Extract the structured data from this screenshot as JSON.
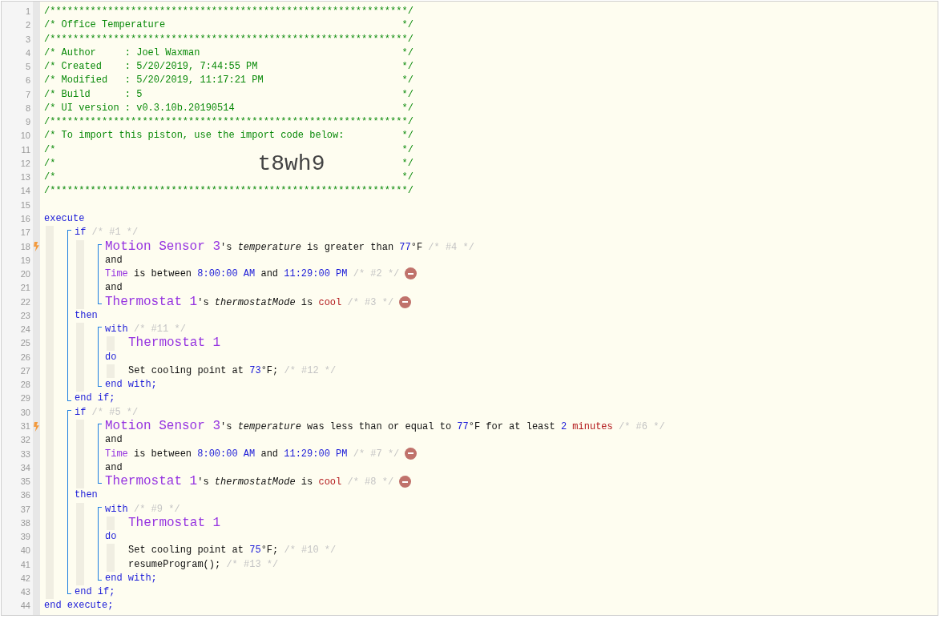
{
  "editor": {
    "lines": [
      {
        "kind": "framed",
        "number": "1",
        "tokens": [
          {
            "text": "/**************************************************************/",
            "kind": "comment"
          }
        ]
      },
      {
        "kind": "framed",
        "number": "2",
        "tokens": [
          {
            "text": "/* Office Temperature",
            "kind": "comment"
          },
          {
            "text": "*/",
            "kind": "comment"
          }
        ]
      },
      {
        "kind": "framed",
        "number": "3",
        "tokens": [
          {
            "text": "/**************************************************************/",
            "kind": "comment"
          }
        ]
      },
      {
        "kind": "framed",
        "number": "4",
        "tokens": [
          {
            "text": "/* Author     : Joel Waxman",
            "kind": "comment"
          },
          {
            "text": "*/",
            "kind": "comment"
          }
        ]
      },
      {
        "kind": "framed",
        "number": "5",
        "tokens": [
          {
            "text": "/* Created    : 5/20/2019, 7:44:55 PM",
            "kind": "comment"
          },
          {
            "text": "*/",
            "kind": "comment"
          }
        ]
      },
      {
        "kind": "framed",
        "number": "6",
        "tokens": [
          {
            "text": "/* Modified   : 5/20/2019, 11:17:21 PM",
            "kind": "comment"
          },
          {
            "text": "*/",
            "kind": "comment"
          }
        ]
      },
      {
        "kind": "framed",
        "number": "7",
        "tokens": [
          {
            "text": "/* Build      : 5",
            "kind": "comment"
          },
          {
            "text": "*/",
            "kind": "comment"
          }
        ]
      },
      {
        "kind": "framed",
        "number": "8",
        "tokens": [
          {
            "text": "/* UI version : v0.3.10b.20190514",
            "kind": "comment"
          },
          {
            "text": "*/",
            "kind": "comment"
          }
        ]
      },
      {
        "kind": "framed",
        "number": "9",
        "tokens": [
          {
            "text": "/**************************************************************/",
            "kind": "comment"
          }
        ]
      },
      {
        "kind": "framed",
        "number": "10",
        "tokens": [
          {
            "text": "/* To import this piston, use the import code below:",
            "kind": "comment"
          },
          {
            "text": "*/",
            "kind": "comment"
          }
        ]
      },
      {
        "kind": "framed",
        "number": "11",
        "tokens": [
          {
            "text": "/*",
            "kind": "comment"
          },
          {
            "text": "*/",
            "kind": "comment"
          }
        ]
      },
      {
        "kind": "framed",
        "number": "12",
        "tokens": [
          {
            "text": "/*",
            "kind": "comment"
          },
          {
            "text": "t8wh9",
            "kind": "code"
          },
          {
            "text": "*/",
            "kind": "comment"
          }
        ]
      },
      {
        "kind": "framed",
        "number": "13",
        "tokens": [
          {
            "text": "/*",
            "kind": "comment"
          },
          {
            "text": "*/",
            "kind": "comment"
          }
        ]
      },
      {
        "kind": "framed",
        "number": "14",
        "tokens": [
          {
            "text": "/**************************************************************/",
            "kind": "comment"
          }
        ]
      },
      {
        "kind": "blank",
        "number": "15"
      },
      {
        "kind": "line",
        "number": "16",
        "trigger": false,
        "removable": false,
        "tokens": [
          {
            "text": "execute",
            "kind": "keyword"
          }
        ]
      },
      {
        "kind": "block",
        "children": [
          {
            "kind": "group",
            "children": [
              {
                "kind": "line",
                "number": "17",
                "trigger": false,
                "removable": false,
                "tokens": [
                  {
                    "text": "if",
                    "kind": "keyword"
                  },
                  {
                    "text": "/* #1 */",
                    "kind": "note"
                  }
                ]
              },
              {
                "kind": "block",
                "children": [
                  {
                    "kind": "group",
                    "children": [
                      {
                        "kind": "line",
                        "number": "18",
                        "trigger": true,
                        "removable": false,
                        "tokens": [
                          {
                            "text": "Motion Sensor 3",
                            "kind": "device"
                          },
                          {
                            "text": "'s",
                            "kind": "plain",
                            "join": true
                          },
                          {
                            "text": "temperature",
                            "kind": "attribute"
                          },
                          {
                            "text": "is greater than",
                            "kind": "plain"
                          },
                          {
                            "text": "77",
                            "kind": "value"
                          },
                          {
                            "text": "°F",
                            "kind": "plain",
                            "join": true
                          },
                          {
                            "text": "/* #4 */",
                            "kind": "note"
                          }
                        ]
                      },
                      {
                        "kind": "line",
                        "number": "19",
                        "trigger": false,
                        "removable": false,
                        "tokens": [
                          {
                            "text": "and",
                            "kind": "plain"
                          }
                        ]
                      },
                      {
                        "kind": "line",
                        "number": "20",
                        "trigger": false,
                        "removable": true,
                        "tokens": [
                          {
                            "text": "Time",
                            "kind": "variable"
                          },
                          {
                            "text": "is between",
                            "kind": "plain"
                          },
                          {
                            "text": "8:00:00 AM",
                            "kind": "value"
                          },
                          {
                            "text": "and",
                            "kind": "plain"
                          },
                          {
                            "text": "11:29:00 PM",
                            "kind": "value"
                          },
                          {
                            "text": "/* #2 */",
                            "kind": "note"
                          }
                        ]
                      },
                      {
                        "kind": "line",
                        "number": "21",
                        "trigger": false,
                        "removable": false,
                        "tokens": [
                          {
                            "text": "and",
                            "kind": "plain"
                          }
                        ]
                      },
                      {
                        "kind": "line",
                        "number": "22",
                        "trigger": false,
                        "removable": true,
                        "tokens": [
                          {
                            "text": "Thermostat 1",
                            "kind": "device"
                          },
                          {
                            "text": "'s",
                            "kind": "plain",
                            "join": true
                          },
                          {
                            "text": "thermostatMode",
                            "kind": "attribute"
                          },
                          {
                            "text": "is",
                            "kind": "plain"
                          },
                          {
                            "text": "cool",
                            "kind": "enum"
                          },
                          {
                            "text": "/* #3 */",
                            "kind": "note"
                          }
                        ]
                      }
                    ]
                  }
                ]
              },
              {
                "kind": "line",
                "number": "23",
                "trigger": false,
                "removable": false,
                "tokens": [
                  {
                    "text": "then",
                    "kind": "keyword"
                  }
                ]
              },
              {
                "kind": "block",
                "children": [
                  {
                    "kind": "group",
                    "children": [
                      {
                        "kind": "line",
                        "number": "24",
                        "trigger": false,
                        "removable": false,
                        "tokens": [
                          {
                            "text": "with",
                            "kind": "keyword"
                          },
                          {
                            "text": "/* #11 */",
                            "kind": "note"
                          }
                        ]
                      },
                      {
                        "kind": "block",
                        "children": [
                          {
                            "kind": "line",
                            "number": "25",
                            "trigger": false,
                            "removable": false,
                            "tokens": [
                              {
                                "text": "Thermostat 1",
                                "kind": "device"
                              }
                            ]
                          }
                        ]
                      },
                      {
                        "kind": "line",
                        "number": "26",
                        "trigger": false,
                        "removable": false,
                        "tokens": [
                          {
                            "text": "do",
                            "kind": "keyword"
                          }
                        ]
                      },
                      {
                        "kind": "block",
                        "children": [
                          {
                            "kind": "line",
                            "number": "27",
                            "trigger": false,
                            "removable": false,
                            "tokens": [
                              {
                                "text": "Set cooling point at",
                                "kind": "plain"
                              },
                              {
                                "text": "73",
                                "kind": "value"
                              },
                              {
                                "text": "°F;",
                                "kind": "plain",
                                "join": true
                              },
                              {
                                "text": "/* #12 */",
                                "kind": "note"
                              }
                            ]
                          }
                        ]
                      },
                      {
                        "kind": "line",
                        "number": "28",
                        "trigger": false,
                        "removable": false,
                        "tokens": [
                          {
                            "text": "end with;",
                            "kind": "keyword"
                          }
                        ]
                      }
                    ]
                  }
                ]
              },
              {
                "kind": "line",
                "number": "29",
                "trigger": false,
                "removable": false,
                "tokens": [
                  {
                    "text": "end if;",
                    "kind": "keyword"
                  }
                ]
              }
            ]
          },
          {
            "kind": "group",
            "children": [
              {
                "kind": "line",
                "number": "30",
                "trigger": false,
                "removable": false,
                "tokens": [
                  {
                    "text": "if",
                    "kind": "keyword"
                  },
                  {
                    "text": "/* #5 */",
                    "kind": "note"
                  }
                ]
              },
              {
                "kind": "block",
                "children": [
                  {
                    "kind": "group",
                    "children": [
                      {
                        "kind": "line",
                        "number": "31",
                        "trigger": true,
                        "removable": false,
                        "tokens": [
                          {
                            "text": "Motion Sensor 3",
                            "kind": "device"
                          },
                          {
                            "text": "'s",
                            "kind": "plain",
                            "join": true
                          },
                          {
                            "text": "temperature",
                            "kind": "attribute"
                          },
                          {
                            "text": "was less than or equal to",
                            "kind": "plain"
                          },
                          {
                            "text": "77",
                            "kind": "value"
                          },
                          {
                            "text": "°F",
                            "kind": "plain",
                            "join": true
                          },
                          {
                            "text": "for at least",
                            "kind": "plain"
                          },
                          {
                            "text": "2",
                            "kind": "value"
                          },
                          {
                            "text": "minutes",
                            "kind": "enum"
                          },
                          {
                            "text": "/* #6 */",
                            "kind": "note"
                          }
                        ]
                      },
                      {
                        "kind": "line",
                        "number": "32",
                        "trigger": false,
                        "removable": false,
                        "tokens": [
                          {
                            "text": "and",
                            "kind": "plain"
                          }
                        ]
                      },
                      {
                        "kind": "line",
                        "number": "33",
                        "trigger": false,
                        "removable": true,
                        "tokens": [
                          {
                            "text": "Time",
                            "kind": "variable"
                          },
                          {
                            "text": "is between",
                            "kind": "plain"
                          },
                          {
                            "text": "8:00:00 AM",
                            "kind": "value"
                          },
                          {
                            "text": "and",
                            "kind": "plain"
                          },
                          {
                            "text": "11:29:00 PM",
                            "kind": "value"
                          },
                          {
                            "text": "/* #7 */",
                            "kind": "note"
                          }
                        ]
                      },
                      {
                        "kind": "line",
                        "number": "34",
                        "trigger": false,
                        "removable": false,
                        "tokens": [
                          {
                            "text": "and",
                            "kind": "plain"
                          }
                        ]
                      },
                      {
                        "kind": "line",
                        "number": "35",
                        "trigger": false,
                        "removable": true,
                        "tokens": [
                          {
                            "text": "Thermostat 1",
                            "kind": "device"
                          },
                          {
                            "text": "'s",
                            "kind": "plain",
                            "join": true
                          },
                          {
                            "text": "thermostatMode",
                            "kind": "attribute"
                          },
                          {
                            "text": "is",
                            "kind": "plain"
                          },
                          {
                            "text": "cool",
                            "kind": "enum"
                          },
                          {
                            "text": "/* #8 */",
                            "kind": "note"
                          }
                        ]
                      }
                    ]
                  }
                ]
              },
              {
                "kind": "line",
                "number": "36",
                "trigger": false,
                "removable": false,
                "tokens": [
                  {
                    "text": "then",
                    "kind": "keyword"
                  }
                ]
              },
              {
                "kind": "block",
                "children": [
                  {
                    "kind": "group",
                    "children": [
                      {
                        "kind": "line",
                        "number": "37",
                        "trigger": false,
                        "removable": false,
                        "tokens": [
                          {
                            "text": "with",
                            "kind": "keyword"
                          },
                          {
                            "text": "/* #9 */",
                            "kind": "note"
                          }
                        ]
                      },
                      {
                        "kind": "block",
                        "children": [
                          {
                            "kind": "line",
                            "number": "38",
                            "trigger": false,
                            "removable": false,
                            "tokens": [
                              {
                                "text": "Thermostat 1",
                                "kind": "device"
                              }
                            ]
                          }
                        ]
                      },
                      {
                        "kind": "line",
                        "number": "39",
                        "trigger": false,
                        "removable": false,
                        "tokens": [
                          {
                            "text": "do",
                            "kind": "keyword"
                          }
                        ]
                      },
                      {
                        "kind": "block",
                        "children": [
                          {
                            "kind": "line",
                            "number": "40",
                            "trigger": false,
                            "removable": false,
                            "tokens": [
                              {
                                "text": "Set cooling point at",
                                "kind": "plain"
                              },
                              {
                                "text": "75",
                                "kind": "value"
                              },
                              {
                                "text": "°F;",
                                "kind": "plain",
                                "join": true
                              },
                              {
                                "text": "/* #10 */",
                                "kind": "note"
                              }
                            ]
                          },
                          {
                            "kind": "line",
                            "number": "41",
                            "trigger": false,
                            "removable": false,
                            "tokens": [
                              {
                                "text": "resumeProgram();",
                                "kind": "plain"
                              },
                              {
                                "text": "/* #13 */",
                                "kind": "note"
                              }
                            ]
                          }
                        ]
                      },
                      {
                        "kind": "line",
                        "number": "42",
                        "trigger": false,
                        "removable": false,
                        "tokens": [
                          {
                            "text": "end with;",
                            "kind": "keyword"
                          }
                        ]
                      }
                    ]
                  }
                ]
              },
              {
                "kind": "line",
                "number": "43",
                "trigger": false,
                "removable": false,
                "tokens": [
                  {
                    "text": "end if;",
                    "kind": "keyword"
                  }
                ]
              }
            ]
          }
        ]
      },
      {
        "kind": "line",
        "number": "44",
        "trigger": false,
        "removable": false,
        "tokens": [
          {
            "text": "end execute;",
            "kind": "keyword"
          }
        ]
      }
    ]
  }
}
